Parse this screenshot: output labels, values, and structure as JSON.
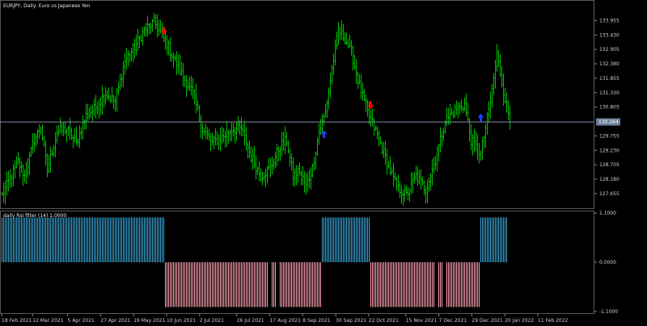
{
  "window": {
    "title": "EURJPY, Daily:  Euro vs Japanese Yen"
  },
  "indicator": {
    "title": "daily Rsi filter (14) 1.0000"
  },
  "colors": {
    "background": "#000000",
    "border": "#5a5a5a",
    "bull_bar": "#00c000",
    "bear_bar": "#00c000",
    "level_line": "#7f8fa6",
    "price_tag_bg": "#6c7f99",
    "hist_up": "#3aa6d8",
    "hist_down": "#ff9fb0",
    "arrow_down": "#ff0000",
    "arrow_up": "#1f3fff"
  },
  "chart_data": [
    {
      "type": "bar",
      "symbol": "EURJPY",
      "timeframe": "Daily",
      "y_ticks": [
        "133.955",
        "133.430",
        "132.905",
        "132.380",
        "131.855",
        "131.330",
        "130.805",
        "129.755",
        "129.230",
        "128.705",
        "128.180",
        "127.655"
      ],
      "y_tick_values": [
        133.955,
        133.43,
        132.905,
        132.38,
        131.855,
        131.33,
        130.805,
        129.755,
        129.23,
        128.705,
        128.18,
        127.655
      ],
      "ylim": [
        127.3,
        134.35
      ],
      "current_price": "130.264",
      "current_price_value": 130.264,
      "anchors": [
        [
          0,
          127.6
        ],
        [
          5,
          128.2
        ],
        [
          10,
          128.8
        ],
        [
          14,
          128.3
        ],
        [
          20,
          129.6
        ],
        [
          24,
          130.1
        ],
        [
          28,
          128.5
        ],
        [
          34,
          129.9
        ],
        [
          40,
          130.0
        ],
        [
          46,
          129.5
        ],
        [
          52,
          130.5
        ],
        [
          58,
          130.8
        ],
        [
          64,
          131.3
        ],
        [
          70,
          131.0
        ],
        [
          76,
          132.5
        ],
        [
          82,
          133.0
        ],
        [
          88,
          133.6
        ],
        [
          94,
          133.9
        ],
        [
          98,
          133.5
        ],
        [
          102,
          133.1
        ],
        [
          106,
          132.6
        ],
        [
          112,
          131.9
        ],
        [
          118,
          131.3
        ],
        [
          124,
          130.0
        ],
        [
          130,
          129.5
        ],
        [
          136,
          129.7
        ],
        [
          142,
          130.0
        ],
        [
          148,
          130.0
        ],
        [
          154,
          129.0
        ],
        [
          160,
          128.3
        ],
        [
          166,
          128.6
        ],
        [
          172,
          129.4
        ],
        [
          176,
          129.6
        ],
        [
          180,
          128.3
        ],
        [
          184,
          128.5
        ],
        [
          188,
          127.9
        ],
        [
          192,
          128.6
        ],
        [
          196,
          129.9
        ],
        [
          200,
          130.6
        ],
        [
          204,
          132.2
        ],
        [
          208,
          133.6
        ],
        [
          212,
          133.3
        ],
        [
          216,
          132.8
        ],
        [
          220,
          131.8
        ],
        [
          226,
          130.6
        ],
        [
          232,
          129.8
        ],
        [
          238,
          128.8
        ],
        [
          244,
          127.9
        ],
        [
          250,
          127.6
        ],
        [
          256,
          128.3
        ],
        [
          262,
          127.8
        ],
        [
          268,
          128.9
        ],
        [
          274,
          130.3
        ],
        [
          280,
          130.7
        ],
        [
          286,
          130.9
        ],
        [
          290,
          129.6
        ],
        [
          296,
          129.1
        ],
        [
          302,
          131.0
        ],
        [
          306,
          132.7
        ],
        [
          310,
          131.4
        ],
        [
          314,
          130.3
        ]
      ],
      "histogram": {
        "ylim": [
          -1.1,
          1.1
        ],
        "y_ticks": [
          "1.1000",
          "0.0000",
          "-1.1000"
        ],
        "y_tick_values": [
          1.1,
          0.0,
          -1.1
        ],
        "segments": [
          {
            "from": 0,
            "to": 100,
            "value": 1.0
          },
          {
            "from": 101,
            "to": 197,
            "value": -1.0
          },
          {
            "from": 198,
            "to": 227,
            "value": 1.0
          },
          {
            "from": 228,
            "to": 295,
            "value": -1.0
          },
          {
            "from": 296,
            "to": 312,
            "value": 1.0
          }
        ],
        "gaps": [
          165,
          166,
          170,
          171,
          268,
          269,
          273,
          274
        ]
      },
      "arrows": [
        {
          "bar": 100,
          "direction": "down",
          "price": 133.55
        },
        {
          "bar": 199,
          "direction": "up",
          "price": 129.85
        },
        {
          "bar": 228,
          "direction": "down",
          "price": 130.85
        },
        {
          "bar": 296,
          "direction": "up",
          "price": 130.45
        }
      ],
      "x_ticks": [
        "18 Feb 2021",
        "12 Mar 2021",
        "5 Apr 2021",
        "27 Apr 2021",
        "19 May 2021",
        "10 Jun 2021",
        "2 Jul 2021",
        "26 Jul 2021",
        "17 Aug 2021",
        "8 Sep 2021",
        "30 Sep 2021",
        "22 Oct 2021",
        "15 Nov 2021",
        "7 Dec 2021",
        "29 Dec 2021",
        "20 Jan 2022",
        "11 Feb 2022"
      ],
      "x_tick_bars": [
        0,
        15,
        32,
        48,
        64,
        80,
        96,
        114,
        130,
        146,
        162,
        178,
        196,
        212,
        228,
        244,
        260
      ]
    }
  ]
}
